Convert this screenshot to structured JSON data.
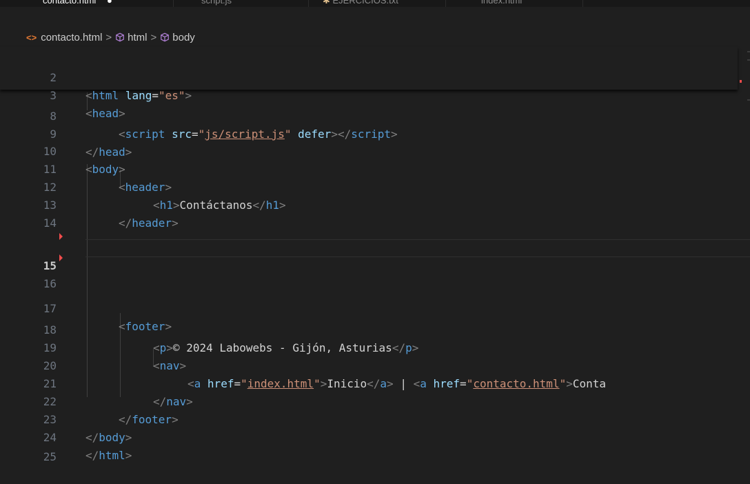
{
  "tabs": [
    {
      "label": "contacto.html",
      "modified": "●",
      "active": true
    },
    {
      "label": "script.js",
      "active": false
    },
    {
      "label": "EJERCICIOS.txt",
      "active": false
    },
    {
      "label": "index.html",
      "active": false
    }
  ],
  "breadcrumb": {
    "file": "contacto.html",
    "sep": ">",
    "items": [
      "html",
      "body"
    ]
  },
  "editor": {
    "current_line": "15",
    "lines": [
      {
        "n": "2",
        "sticky": true
      },
      {
        "n": "3",
        "sticky": true
      },
      {
        "n": "8"
      },
      {
        "n": "9"
      },
      {
        "n": "10"
      },
      {
        "n": "11"
      },
      {
        "n": "12"
      },
      {
        "n": "13"
      },
      {
        "n": "14"
      },
      {
        "n": "15"
      },
      {
        "n": "16"
      },
      {
        "n": "17"
      },
      {
        "n": "18"
      },
      {
        "n": "19"
      },
      {
        "n": "20"
      },
      {
        "n": "21"
      },
      {
        "n": "22"
      },
      {
        "n": "23"
      },
      {
        "n": "24"
      },
      {
        "n": "25"
      }
    ],
    "tokens": {
      "html_tag": "html",
      "lang_attr": "lang",
      "lang_value": "\"es\"",
      "head_tag": "head",
      "script_tag": "script",
      "src_attr": "src",
      "src_value": "js/script.js",
      "defer_attr": "defer",
      "body_tag": "body",
      "header_tag": "header",
      "h1_tag": "h1",
      "h1_text": "Contáctanos",
      "footer_tag": "footer",
      "p_tag": "p",
      "p_text": "© 2024 Labowebs - Gijón, Asturias",
      "nav_tag": "nav",
      "a_tag": "a",
      "href_attr": "href",
      "href1": "index.html",
      "link1_text": "Inicio",
      "pipe": " | ",
      "href2": "contacto.html",
      "link2_text": "Conta"
    }
  },
  "colors": {
    "background": "#1f1f1f",
    "tag": "#569cd6",
    "attribute": "#9cdcfe",
    "string": "#ce9178",
    "text": "#d4d4d4",
    "line_number": "#6e7681",
    "diff_marker": "#f14c4c"
  }
}
